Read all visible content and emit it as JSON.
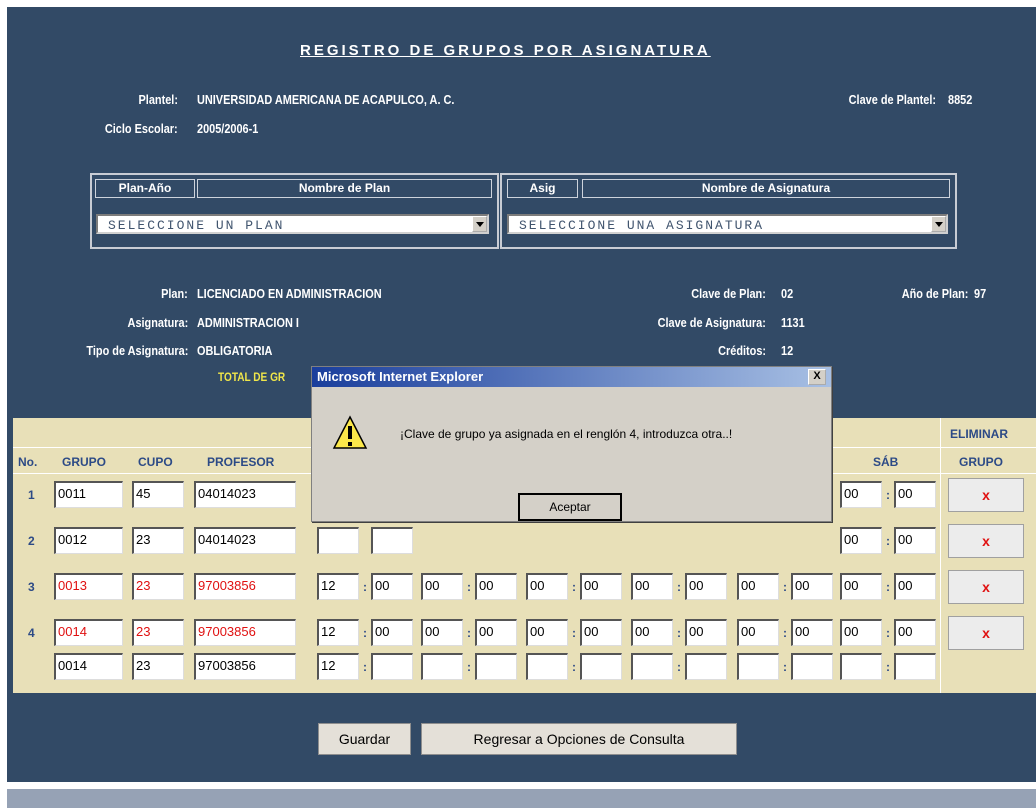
{
  "page": {
    "title": "REGISTRO DE GRUPOS POR ASIGNATURA",
    "plantel_label": "Plantel:",
    "plantel_value": "UNIVERSIDAD AMERICANA DE ACAPULCO, A. C.",
    "clave_plantel_label": "Clave de Plantel:",
    "clave_plantel_value": "8852",
    "ciclo_label": "Ciclo Escolar:",
    "ciclo_value": "2005/2006-1"
  },
  "plan_select": {
    "header_code": "Plan-Año",
    "header_name": "Nombre de Plan",
    "value": "SELECCIONE UN PLAN"
  },
  "asig_select": {
    "header_code": "Asig",
    "header_name": "Nombre de Asignatura",
    "value": "SELECCIONE UNA ASIGNATURA"
  },
  "info": {
    "plan_label": "Plan:",
    "plan_value": "LICENCIADO EN ADMINISTRACION",
    "asignatura_label": "Asignatura:",
    "asignatura_value": "ADMINISTRACION I",
    "tipo_label": "Tipo de Asignatura:",
    "tipo_value": "OBLIGATORIA",
    "total_label": "TOTAL DE GR",
    "clave_plan_label": "Clave de Plan:",
    "clave_plan_value": "02",
    "anio_plan_label": "Año de Plan:",
    "anio_plan_value": "97",
    "clave_asig_label": "Clave de Asignatura:",
    "clave_asig_value": "1131",
    "creditos_label": "Créditos:",
    "creditos_value": "12"
  },
  "table": {
    "headers": {
      "no": "No.",
      "grupo": "GRUPO",
      "cupo": "CUPO",
      "profesor": "PROFESOR",
      "sab": "SÁB",
      "eliminar": "ELIMINAR",
      "eliminar_grupo": "GRUPO",
      "delete_symbol": "x"
    },
    "rows": [
      {
        "no": "1",
        "grupo": "0011",
        "cupo": "45",
        "profesor": "04014023",
        "sab_h": "00",
        "sab_m": "00",
        "highlight": false
      },
      {
        "no": "2",
        "grupo": "0012",
        "cupo": "23",
        "profesor": "04014023",
        "sab_h": "00",
        "sab_m": "00",
        "highlight": false
      },
      {
        "no": "3",
        "grupo": "0013",
        "cupo": "23",
        "profesor": "97003856",
        "times": [
          "12",
          "00",
          "00",
          "00",
          "00",
          "00",
          "00",
          "00",
          "00",
          "00",
          "00",
          "00"
        ],
        "highlight": true
      },
      {
        "no": "4",
        "grupo": "0014",
        "cupo": "23",
        "profesor": "97003856",
        "times": [
          "12",
          "00",
          "00",
          "00",
          "00",
          "00",
          "00",
          "00",
          "00",
          "00",
          "00",
          "00"
        ],
        "highlight": true
      },
      {
        "no": "",
        "grupo": "0014",
        "cupo": "23",
        "profesor": "97003856",
        "times": [
          "12",
          "",
          "",
          "",
          "",
          "",
          "",
          "",
          "",
          "",
          "",
          ""
        ],
        "highlight": false
      }
    ]
  },
  "buttons": {
    "guardar": "Guardar",
    "regresar": "Regresar a Opciones de Consulta"
  },
  "dialog": {
    "title": "Microsoft Internet Explorer",
    "close": "X",
    "message": "¡Clave de grupo ya asignada en el renglón 4, introduzca otra..!",
    "ok": "Aceptar",
    "icon": "warning-icon"
  },
  "colors": {
    "background": "#324a66",
    "table_bg": "#e8e0b8",
    "header_text": "#2c4a86",
    "error_text": "#e01010",
    "total_label": "#f0e64a"
  }
}
